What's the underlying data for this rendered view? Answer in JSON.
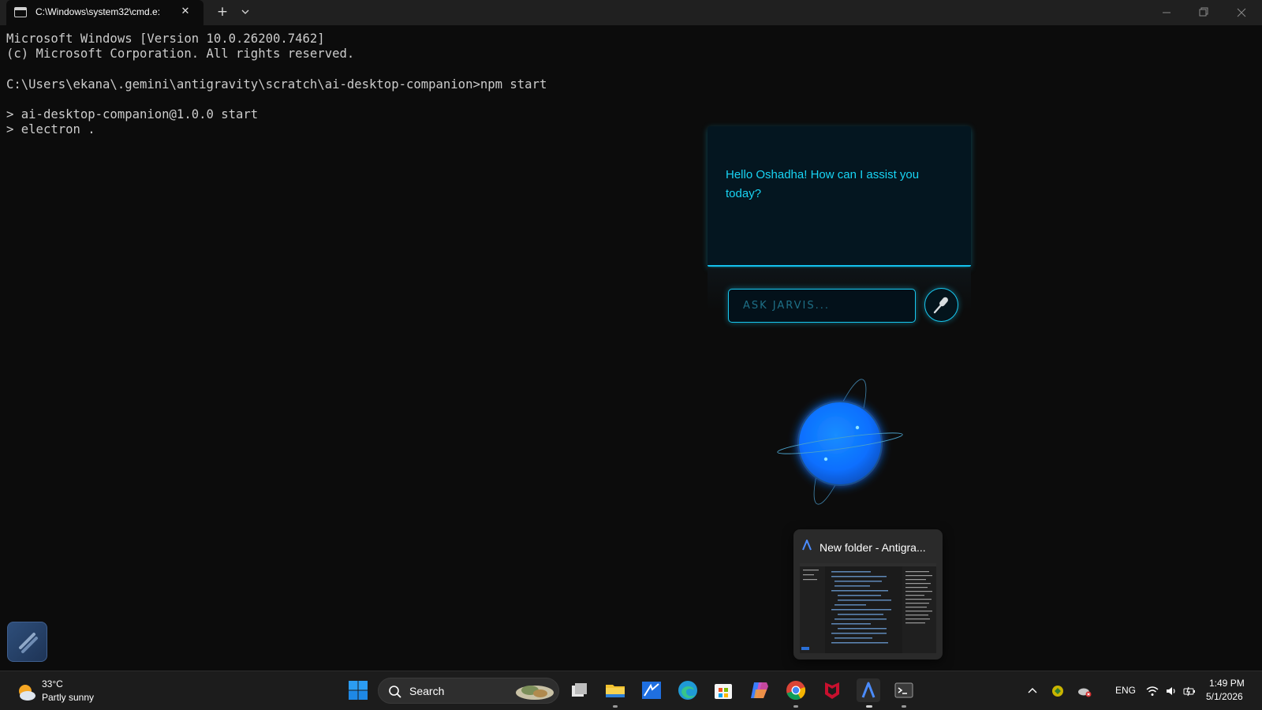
{
  "window": {
    "tab_title": "C:\\Windows\\system32\\cmd.e:",
    "tab_icon": "terminal-icon",
    "new_tab_label": "+",
    "close_tab_label": "✕"
  },
  "terminal": {
    "lines": [
      "Microsoft Windows [Version 10.0.26200.7462]",
      "(c) Microsoft Corporation. All rights reserved.",
      "",
      "C:\\Users\\ekana\\.gemini\\antigravity\\scratch\\ai-desktop-companion>npm start",
      "",
      "> ai-desktop-companion@1.0.0 start",
      "> electron ."
    ]
  },
  "jarvis": {
    "message": "Hello Oshadha! How can I assist you today?",
    "input_placeholder": "ASK JARVIS...",
    "input_value": "",
    "mic_icon": "microphone-icon",
    "accent_color": "#18c8f0",
    "orb_color": "#0a6fff"
  },
  "thumbnail": {
    "title": "New folder - Antigra...",
    "icon": "antigravity-icon"
  },
  "taskbar": {
    "weather": {
      "temp": "33°C",
      "desc": "Partly sunny",
      "icon": "partly-sunny-icon"
    },
    "search_label": "Search",
    "apps": [
      "start-icon",
      "task-view-icon",
      "file-explorer-icon",
      "app-icon",
      "edge-icon",
      "store-icon",
      "copilot-icon",
      "chrome-icon",
      "mcafee-icon",
      "antigravity-icon",
      "terminal-icon"
    ],
    "tray": {
      "lang": "ENG",
      "time": "1:49 PM",
      "date": "5/1/2026"
    }
  }
}
